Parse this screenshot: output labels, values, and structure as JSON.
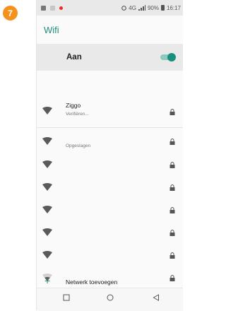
{
  "step_badge": "7",
  "statusbar": {
    "network": "4G",
    "battery": "90%",
    "time": "16:17"
  },
  "header": {
    "title": "Wifi"
  },
  "wifi_toggle": {
    "label": "Aan",
    "state": "on"
  },
  "networks": [
    {
      "name": "Ziggo",
      "status": "Verifiëren...",
      "secured": true
    },
    {
      "name": "",
      "status": "Opgeslagen",
      "secured": true
    },
    {
      "name": "",
      "status": "",
      "secured": true
    },
    {
      "name": "",
      "status": "",
      "secured": true
    },
    {
      "name": "",
      "status": "",
      "secured": true
    },
    {
      "name": "",
      "status": "",
      "secured": true
    },
    {
      "name": "",
      "status": "",
      "secured": true
    },
    {
      "name": "",
      "status": "",
      "secured": true
    }
  ],
  "add_network": {
    "label": "Netwerk toevoegen"
  },
  "colors": {
    "accent": "#1e8e7c",
    "badge": "#f5921e"
  }
}
